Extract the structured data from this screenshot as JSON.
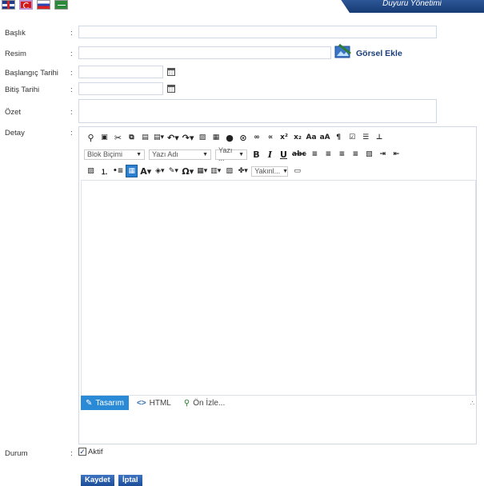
{
  "header": {
    "title": "Duyuru Yönetimi"
  },
  "languages": [
    "en-flag-icon",
    "tr-flag-icon",
    "ru-flag-icon",
    "sa-flag-icon"
  ],
  "form": {
    "baslik_label": "Başlık",
    "resim_label": "Resim",
    "gorsel_ekle": "Görsel Ekle",
    "baslangic_label": "Başlangıç Tarihi",
    "bitis_label": "Bitiş Tarihi",
    "ozet_label": "Özet",
    "detay_label": "Detay",
    "durum_label": "Durum",
    "aktif_label": "Aktif",
    "colon": ":"
  },
  "editor": {
    "block_format": "Blok Biçimi",
    "font_name": "Yazı Adı",
    "font_size": "Yazı ...",
    "zoom": "Yakınl...",
    "modes": {
      "design": "Tasarım",
      "html": "HTML",
      "preview": "Ön İzle..."
    }
  },
  "buttons": {
    "save": "Kaydet",
    "cancel": "İptal"
  },
  "colors": {
    "accent": "#2a8ad6",
    "header": "#1f4585",
    "link": "#1a3f7a"
  }
}
